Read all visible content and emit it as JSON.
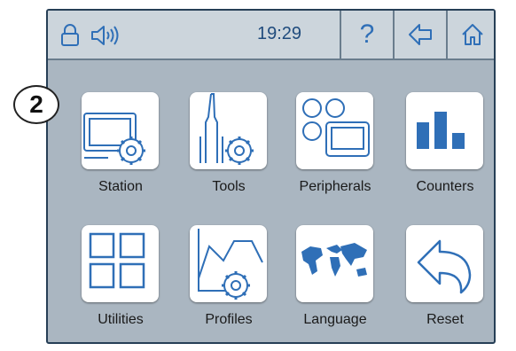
{
  "callout": {
    "number": "2"
  },
  "topbar": {
    "time": "19:29",
    "help_label": "?",
    "icons": [
      "lock-icon",
      "speaker-icon",
      "back-arrow-icon",
      "home-icon"
    ]
  },
  "menu": {
    "items": [
      {
        "label": "Station",
        "icon": "station-icon"
      },
      {
        "label": "Tools",
        "icon": "tools-icon"
      },
      {
        "label": "Peripherals",
        "icon": "peripherals-icon"
      },
      {
        "label": "Counters",
        "icon": "counters-icon"
      },
      {
        "label": "Utilities",
        "icon": "utilities-icon"
      },
      {
        "label": "Profiles",
        "icon": "profiles-icon"
      },
      {
        "label": "Language",
        "icon": "world-map-icon"
      },
      {
        "label": "Reset",
        "icon": "reset-icon"
      }
    ]
  },
  "colors": {
    "accent": "#2f6fb7",
    "panel": "#aab6c1",
    "topbar": "#ccd5dc",
    "frame": "#263f56"
  }
}
